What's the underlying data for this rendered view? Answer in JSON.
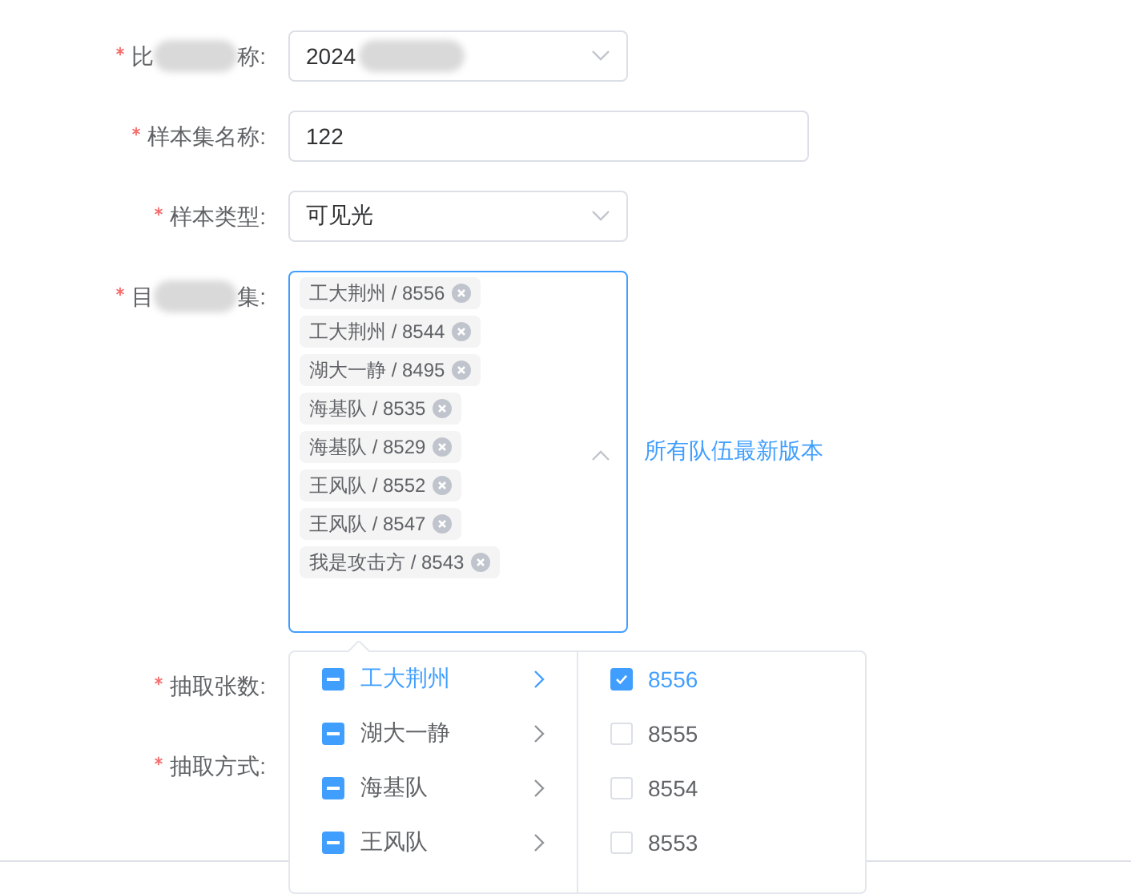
{
  "form": {
    "fields": [
      {
        "kind": "select",
        "required": true,
        "label": [
          "比",
          "称:"
        ],
        "value": "2024",
        "value_redacted": true,
        "expanded": false
      },
      {
        "kind": "input",
        "required": true,
        "label": [
          "样本集名称:"
        ],
        "value": "122"
      },
      {
        "kind": "select",
        "required": true,
        "label": [
          "样本类型:"
        ],
        "value": "可见光",
        "value_redacted": false,
        "expanded": false
      },
      {
        "kind": "tags",
        "required": true,
        "label": [
          "目",
          "集:"
        ],
        "expanded": true,
        "tags": [
          {
            "text": "工大荆州 / 8556"
          },
          {
            "text": "工大荆州 / 8544"
          },
          {
            "text": "湖大一静 / 8495"
          },
          {
            "text": "海基队 / 8535"
          },
          {
            "text": "海基队 / 8529"
          },
          {
            "text": "王风队 / 8552"
          },
          {
            "text": "王风队 / 8547"
          },
          {
            "text": "我是攻击方 / 8543"
          }
        ],
        "link": "所有队伍最新版本"
      },
      {
        "kind": "covered",
        "required": true,
        "label": [
          "抽取张数:"
        ]
      },
      {
        "kind": "covered",
        "required": true,
        "label": [
          "抽取方式:"
        ]
      }
    ]
  },
  "cascader": {
    "groups": [
      {
        "label": "工大荆州",
        "selected": true,
        "indeterminate": true
      },
      {
        "label": "湖大一静",
        "selected": false,
        "indeterminate": true
      },
      {
        "label": "海基队",
        "selected": false,
        "indeterminate": true
      },
      {
        "label": "王风队",
        "selected": false,
        "indeterminate": true
      }
    ],
    "options": [
      {
        "label": "8556",
        "checked": true
      },
      {
        "label": "8555",
        "checked": false
      },
      {
        "label": "8554",
        "checked": false
      },
      {
        "label": "8553",
        "checked": false
      }
    ]
  }
}
